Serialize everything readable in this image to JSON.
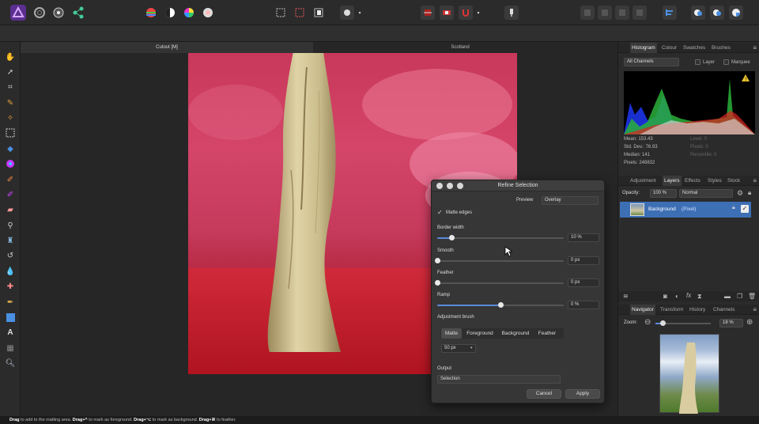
{
  "tabs": {
    "doc1": "Cutout [M]",
    "doc2": "Scotland"
  },
  "histogram": {
    "tabs": [
      "Histogram",
      "Colour",
      "Swatches",
      "Brushes"
    ],
    "channel": "All Channels",
    "layer_label": "Layer",
    "marquee_label": "Marquee",
    "stats_left": [
      "Mean: 153.43",
      "Std. Dev.: 76.93",
      "Median: 141",
      "Pixels: 248832"
    ],
    "stats_right": [
      "Level: 0",
      "Pixels: 0",
      "Percentile: 0"
    ]
  },
  "layers": {
    "tabs": [
      "Adjustment",
      "Layers",
      "Effects",
      "Styles",
      "Stock"
    ],
    "opacity_label": "Opacity:",
    "opacity_value": "100 %",
    "blend_mode": "Normal",
    "layer_name": "Background",
    "layer_type": "(Pixel)"
  },
  "navigator": {
    "tabs": [
      "Navigator",
      "Transform",
      "History",
      "Channels"
    ],
    "zoom_label": "Zoom:",
    "zoom_value": "18 %"
  },
  "dialog": {
    "title": "Refine Selection",
    "preview_label": "Preview",
    "preview_value": "Overlay",
    "matte_edges": "Matte edges",
    "border_width": {
      "label": "Border width",
      "value": "10 %",
      "pos": 0.11
    },
    "smooth": {
      "label": "Smooth",
      "value": "0 px",
      "pos": 0
    },
    "feather": {
      "label": "Feather",
      "value": "0 px",
      "pos": 0
    },
    "ramp": {
      "label": "Ramp",
      "value": "0 %",
      "pos": 0.5
    },
    "adjustment_brush": "Adjustment brush",
    "brush_modes": [
      "Matte",
      "Foreground",
      "Background",
      "Feather"
    ],
    "brush_size": "50 px",
    "output_label": "Output",
    "output_value": "Selection",
    "cancel": "Cancel",
    "apply": "Apply"
  },
  "status": {
    "k1": "Drag",
    "t1": " to add to the matting area. ",
    "k2": "Drag+^",
    "t2": " to mark as foreground. ",
    "k3": "Drag+⌥",
    "t3": " to mark as background. ",
    "k4": "Drag+⌘",
    "t4": " to feather."
  },
  "colors": {
    "accent": "#5a8ad8",
    "overlay": "#c8385a",
    "layer_selected": "#3d6fb5"
  }
}
